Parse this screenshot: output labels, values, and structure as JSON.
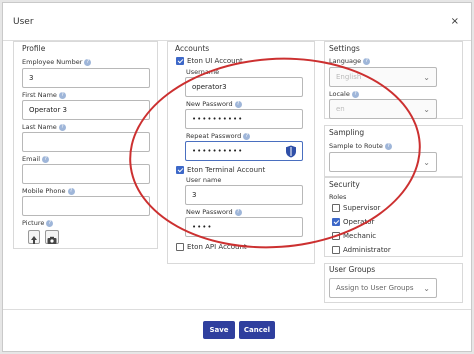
{
  "dialog": {
    "title": "User",
    "close_label": "×"
  },
  "profile": {
    "title": "Profile",
    "employee_number_label": "Employee Number",
    "employee_number_value": "3",
    "first_name_label": "First Name",
    "first_name_value": "Operator 3",
    "last_name_label": "Last Name",
    "last_name_value": "",
    "email_label": "Email",
    "email_value": "",
    "mobile_phone_label": "Mobile Phone",
    "mobile_phone_value": "",
    "picture_label": "Picture"
  },
  "accounts": {
    "title": "Accounts",
    "eton_ui_label": "Eton UI Account",
    "eton_ui_checked": true,
    "username_label": "Username",
    "username_value": "operator3",
    "new_password_label": "New Password",
    "new_password_value": "••••••••••",
    "repeat_password_label": "Repeat Password",
    "repeat_password_value": "••••••••••",
    "terminal_label": "Eton Terminal Account",
    "terminal_checked": true,
    "terminal_username_label": "User name",
    "terminal_username_value": "3",
    "terminal_password_label": "New Password",
    "terminal_password_value": "••••",
    "api_label": "Eton API Account",
    "api_checked": false
  },
  "settings": {
    "title": "Settings",
    "language_label": "Language",
    "language_value": "English",
    "locale_label": "Locale",
    "locale_value": "en"
  },
  "sampling": {
    "title": "Sampling",
    "sample_route_label": "Sample to Route",
    "sample_route_value": ""
  },
  "security": {
    "title": "Security",
    "roles_label": "Roles",
    "roles": [
      {
        "label": "Supervisor",
        "checked": false
      },
      {
        "label": "Operator",
        "checked": true
      },
      {
        "label": "Mechanic",
        "checked": false
      },
      {
        "label": "Administrator",
        "checked": false
      }
    ]
  },
  "user_groups": {
    "title": "User Groups",
    "placeholder": "Assign to User Groups"
  },
  "footer": {
    "save_label": "Save",
    "cancel_label": "Cancel"
  },
  "colors": {
    "primary": "#2f3f9e",
    "annotation": "#cc3030",
    "check": "#3d68c8"
  }
}
